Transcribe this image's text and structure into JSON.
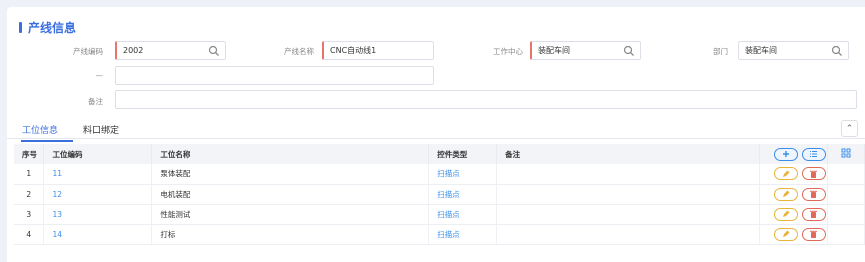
{
  "section": {
    "title": "产线信息"
  },
  "form": {
    "line_code": {
      "label": "产线编码",
      "value": "2002"
    },
    "line_name": {
      "label": "产线名称",
      "value": "CNC自动线1"
    },
    "work_center": {
      "label": "工作中心",
      "value": "装配车间"
    },
    "department": {
      "label": "部门",
      "value": "装配车间"
    },
    "extra": {
      "label": "—",
      "value": ""
    },
    "remark": {
      "label": "备注",
      "value": ""
    }
  },
  "tabs": [
    {
      "label": "工位信息",
      "active": true
    },
    {
      "label": "料口绑定",
      "active": false
    }
  ],
  "table": {
    "headers": [
      "序号",
      "工位编码",
      "工位名称",
      "控件类型",
      "备注"
    ],
    "rows": [
      {
        "index": "1",
        "code": "11",
        "name": "泵体装配",
        "control": "扫描点",
        "remark": ""
      },
      {
        "index": "2",
        "code": "12",
        "name": "电机装配",
        "control": "扫描点",
        "remark": ""
      },
      {
        "index": "3",
        "code": "13",
        "name": "性能测试",
        "control": "扫描点",
        "remark": ""
      },
      {
        "index": "4",
        "code": "14",
        "name": "打标",
        "control": "扫描点",
        "remark": ""
      }
    ]
  },
  "colors": {
    "accent": "#3b6fe0",
    "link": "#3b8ee8",
    "edit": "#e8b53a",
    "delete": "#e06a5a",
    "required": "#e8746a"
  }
}
